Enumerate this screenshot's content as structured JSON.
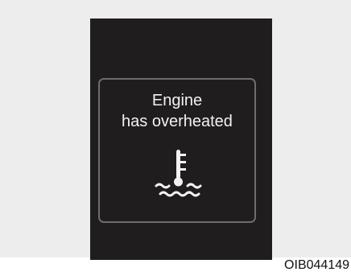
{
  "warning": {
    "line1": "Engine",
    "line2": "has overheated",
    "icon": "engine-coolant-temperature-icon"
  },
  "figure_code": "OIB044149",
  "colors": {
    "display_background": "#201d1e",
    "text": "#f2f2f2",
    "box_border": "#6f6c6c",
    "frame_background": "#ededed"
  }
}
